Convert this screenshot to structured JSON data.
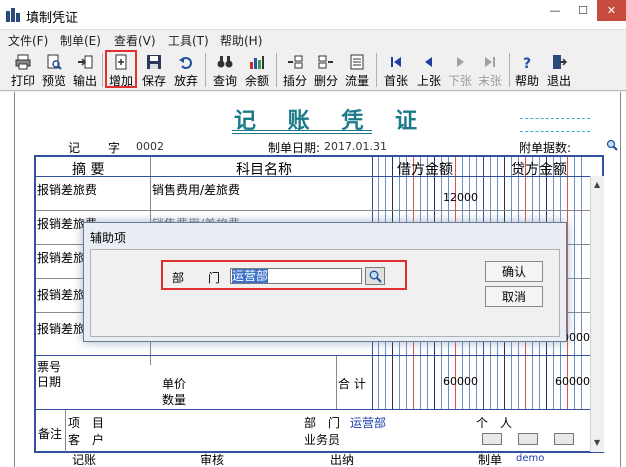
{
  "window": {
    "title": "填制凭证"
  },
  "menu": [
    "文件(F)",
    "制单(E)",
    "查看(V)",
    "工具(T)",
    "帮助(H)"
  ],
  "toolbar": {
    "print": "打印",
    "preview": "预览",
    "export": "输出",
    "add": "增加",
    "save": "保存",
    "discard": "放弃",
    "query": "查询",
    "balance": "余额",
    "insert_row": "插分",
    "delete_row": "删分",
    "cashflow": "流量",
    "first": "首张",
    "prev": "上张",
    "next": "下张",
    "last": "末张",
    "help": "帮助",
    "exit": "退出"
  },
  "voucher": {
    "title": "记 账 凭 证",
    "type_label": "记",
    "number_label": "字",
    "number": "0002",
    "date_label": "制单日期:",
    "date": "2017.01.31",
    "attachments_label": "附单据数:"
  },
  "grid": {
    "headers": {
      "summary": "摘 要",
      "account": "科目名称",
      "debit": "借方金额",
      "credit": "贷方金额"
    },
    "rows": [
      {
        "summary": "报销差旅费",
        "account": "销售费用/差旅费",
        "debit": "12000",
        "credit": ""
      },
      {
        "summary": "报销差旅费",
        "account": "销售费用/差旅费",
        "debit": "",
        "credit": ""
      },
      {
        "summary": "报销差旅",
        "account": "",
        "debit": "",
        "credit": ""
      },
      {
        "summary": "报销差旅",
        "account": "",
        "debit": "",
        "credit": ""
      },
      {
        "summary": "报销差旅",
        "account": "",
        "debit": "",
        "credit": "0000"
      }
    ],
    "ticket_no_label": "票号",
    "date_label": "日期",
    "unit_price_label": "单价",
    "quantity_label": "数量",
    "total_label": "合 计",
    "total_debit": "60000",
    "total_credit": "60000"
  },
  "notes": {
    "label": "备注",
    "project_label": "项　目",
    "customer_label": "客　户",
    "department_label": "部　门",
    "department_value": "运营部",
    "individual_label": "个　人",
    "salesperson_label": "业务员"
  },
  "footer": {
    "bookkeeper_label": "记账",
    "reviewer_label": "审核",
    "cashier_label": "出纳",
    "maker_label": "制单",
    "maker_value": "demo"
  },
  "dialog": {
    "title": "辅助项",
    "dept_label": "部　　门",
    "dept_value": "运营部",
    "ok": "确认",
    "cancel": "取消"
  }
}
